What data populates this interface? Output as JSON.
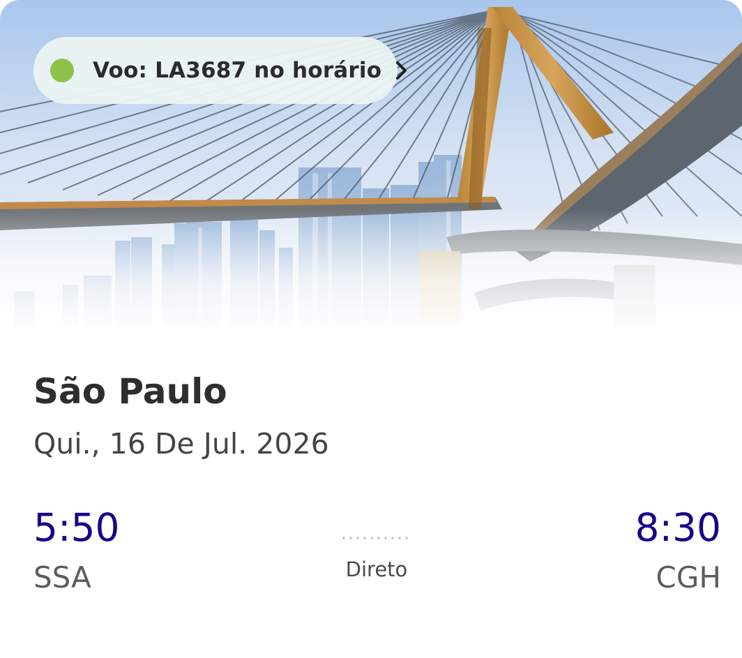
{
  "flight_status": {
    "text": "Voo: LA3687 no horário",
    "status_color": "#8cc34a",
    "icon": "chevron-right-icon"
  },
  "destination": {
    "city": "São Paulo",
    "date": "Qui., 16 De Jul. 2026"
  },
  "departure": {
    "time": "5:50",
    "airport": "SSA"
  },
  "arrival": {
    "time": "8:30",
    "airport": "CGH"
  },
  "route": {
    "type": "Direto"
  },
  "colors": {
    "time_accent": "#1b0088",
    "chip_background": "#ecf4f3"
  }
}
